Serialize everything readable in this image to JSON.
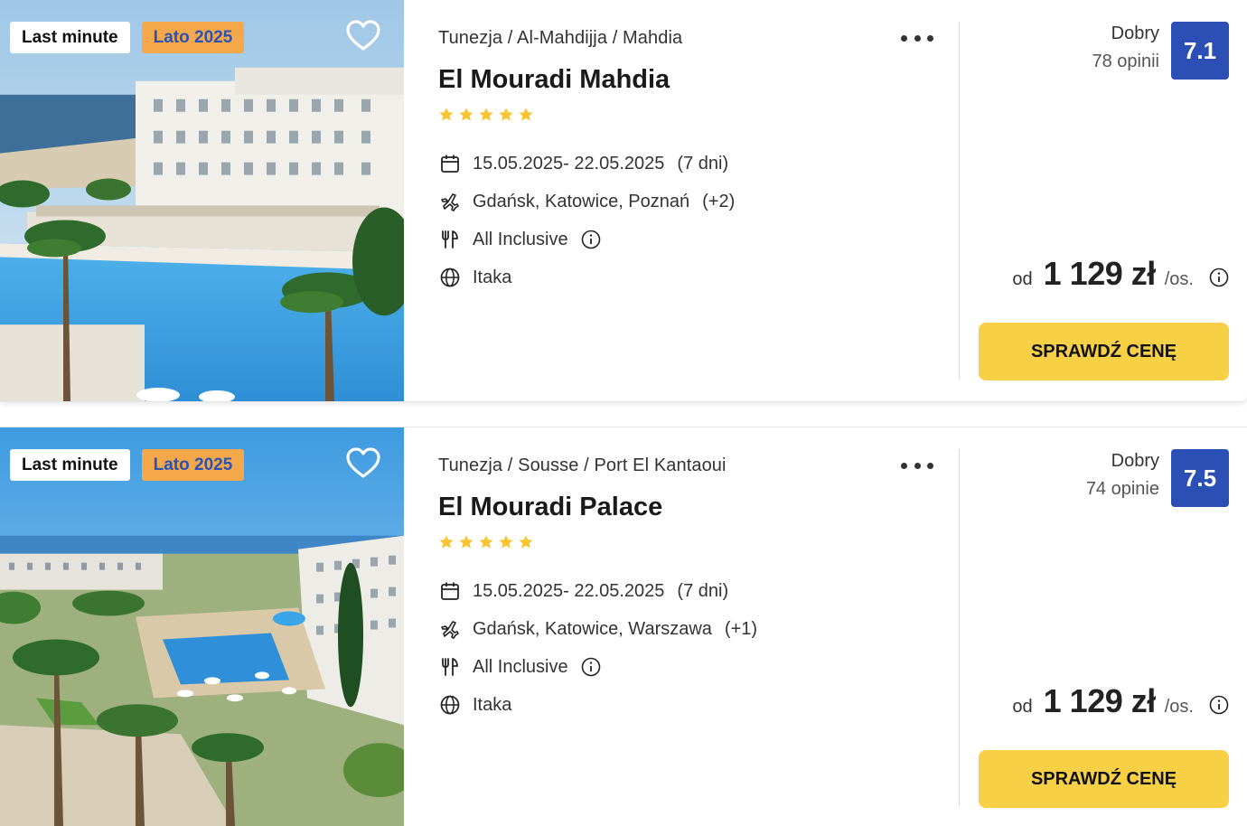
{
  "colors": {
    "score_bg": "#2b4fb5",
    "cta_bg": "#f7d046",
    "badge_orange_bg": "#f5a84a",
    "badge_orange_text": "#2b53b6",
    "star": "#f7c531"
  },
  "offers": [
    {
      "badges": [
        "Last minute",
        "Lato 2025"
      ],
      "breadcrumb": [
        "Tunezja",
        "Al-Mahdijja",
        "Mahdia"
      ],
      "hotel_name": "El Mouradi Mahdia",
      "stars": 5,
      "dates": "15.05.2025- 22.05.2025",
      "duration": "(7 dni)",
      "departures": "Gdańsk, Katowice, Poznań",
      "departures_more": "(+2)",
      "board": "All Inclusive",
      "operator": "Itaka",
      "rating_label": "Dobry",
      "rating_count": "78 opinii",
      "score": "7.1",
      "price_prefix": "od",
      "price": "1 129 zł",
      "price_unit": "/os.",
      "cta": "SPRAWDŹ CENĘ",
      "image": "hotel-photo-pool-sea"
    },
    {
      "badges": [
        "Last minute",
        "Lato 2025"
      ],
      "breadcrumb": [
        "Tunezja",
        "Sousse",
        "Port El Kantaoui"
      ],
      "hotel_name": "El Mouradi Palace",
      "stars": 5,
      "dates": "15.05.2025- 22.05.2025",
      "duration": "(7 dni)",
      "departures": "Gdańsk, Katowice, Warszawa",
      "departures_more": "(+1)",
      "board": "All Inclusive",
      "operator": "Itaka",
      "rating_label": "Dobry",
      "rating_count": "74 opinie",
      "score": "7.5",
      "price_prefix": "od",
      "price": "1 129 zł",
      "price_unit": "/os.",
      "cta": "SPRAWDŹ CENĘ",
      "image": "hotel-photo-garden-pool"
    }
  ]
}
